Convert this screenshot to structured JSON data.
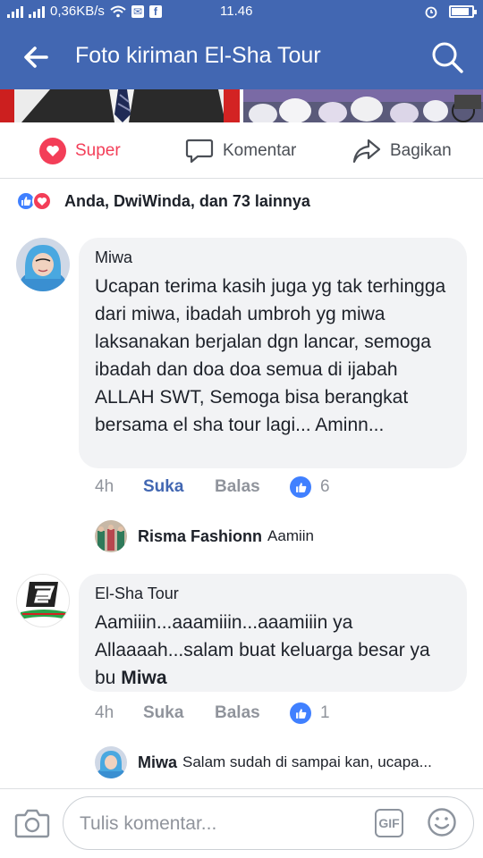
{
  "status_bar": {
    "network_speed": "0,36KB/s",
    "time": "11.46",
    "battery_level_percent": 85
  },
  "app_bar": {
    "title": "Foto kiriman El-Sha Tour",
    "back_icon": "arrow-left-icon",
    "search_icon": "search-icon"
  },
  "actions": {
    "super_label": "Super",
    "comment_label": "Komentar",
    "share_label": "Bagikan"
  },
  "reactions": {
    "summary": "Anda, DwiWinda, dan 73 lainnya"
  },
  "comments": [
    {
      "author": "Miwa",
      "text": "Ucapan terima kasih juga yg tak terhingga dari miwa, ibadah umbroh yg miwa laksanakan berjalan dgn lancar, semoga ibadah dan doa doa semua di ijabah ALLAH SWT, Semoga bisa berangkat bersama el sha tour lagi... Aminn...",
      "time": "4h",
      "like_label": "Suka",
      "reply_label": "Balas",
      "like_count": "6",
      "reply": {
        "author": "Risma Fashionn",
        "text": "Aamiin"
      }
    },
    {
      "author": "El-Sha Tour",
      "text_prefix": "Aamiiin...aaamiiin...aaamiiin ya Allaaaah...salam buat keluarga besar ya bu",
      "text_mention": "Miwa",
      "time": "4h",
      "like_label": "Suka",
      "reply_label": "Balas",
      "like_count": "1",
      "reply": {
        "author": "Miwa",
        "text": "Salam sudah di sampai kan, ucapa..."
      }
    }
  ],
  "composer": {
    "placeholder": "Tulis komentar...",
    "gif_label": "GIF"
  },
  "colors": {
    "brand": "#4267b2",
    "love": "#f33e58",
    "like": "#4080ff",
    "bubble": "#f2f3f5"
  }
}
